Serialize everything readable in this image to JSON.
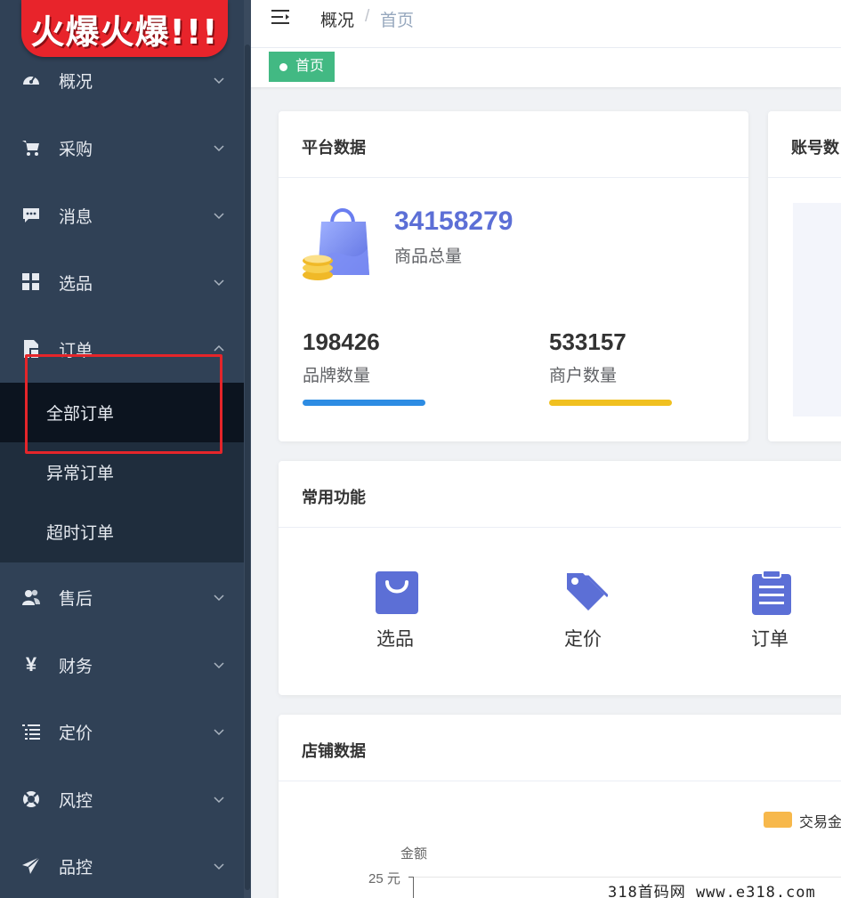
{
  "banner": {
    "text": "火爆火爆!!!"
  },
  "sidebar": {
    "items": [
      {
        "label": "概况",
        "icon": "dashboard-icon"
      },
      {
        "label": "采购",
        "icon": "cart-icon"
      },
      {
        "label": "消息",
        "icon": "message-icon"
      },
      {
        "label": "选品",
        "icon": "grid-icon"
      },
      {
        "label": "订单",
        "icon": "order-icon"
      },
      {
        "label": "售后",
        "icon": "user-group-icon"
      },
      {
        "label": "财务",
        "icon": "yen-icon"
      },
      {
        "label": "定价",
        "icon": "list-icon"
      },
      {
        "label": "风控",
        "icon": "lifebuoy-icon"
      },
      {
        "label": "品控",
        "icon": "send-icon"
      }
    ],
    "order_submenu": [
      {
        "label": "全部订单",
        "active": true
      },
      {
        "label": "异常订单"
      },
      {
        "label": "超时订单"
      }
    ]
  },
  "header": {
    "breadcrumb": [
      "概况",
      "首页"
    ],
    "separator": "/"
  },
  "tags": {
    "home": "首页"
  },
  "platform": {
    "title": "平台数据",
    "total_value": "34158279",
    "total_label": "商品总量",
    "brand_value": "198426",
    "brand_label": "品牌数量",
    "merchant_value": "533157",
    "merchant_label": "商户数量"
  },
  "account": {
    "title": "账号数"
  },
  "functions": {
    "title": "常用功能",
    "items": [
      {
        "label": "选品",
        "icon": "shopping-bag-icon"
      },
      {
        "label": "定价",
        "icon": "price-tag-icon"
      },
      {
        "label": "订单",
        "icon": "clipboard-icon"
      }
    ]
  },
  "store": {
    "title": "店铺数据",
    "legend": "交易金",
    "y_axis_name": "金额",
    "y_tick": "25 元"
  },
  "watermark": "318首码网  www.e318.com",
  "colors": {
    "sidebar_bg": "#304156",
    "accent": "#5c6fd6",
    "tag_green": "#42b983",
    "bar_blue": "#2d8ce3",
    "bar_yellow": "#f0c020",
    "legend_orange": "#f7b84b",
    "highlight_red": "#e5252a"
  }
}
